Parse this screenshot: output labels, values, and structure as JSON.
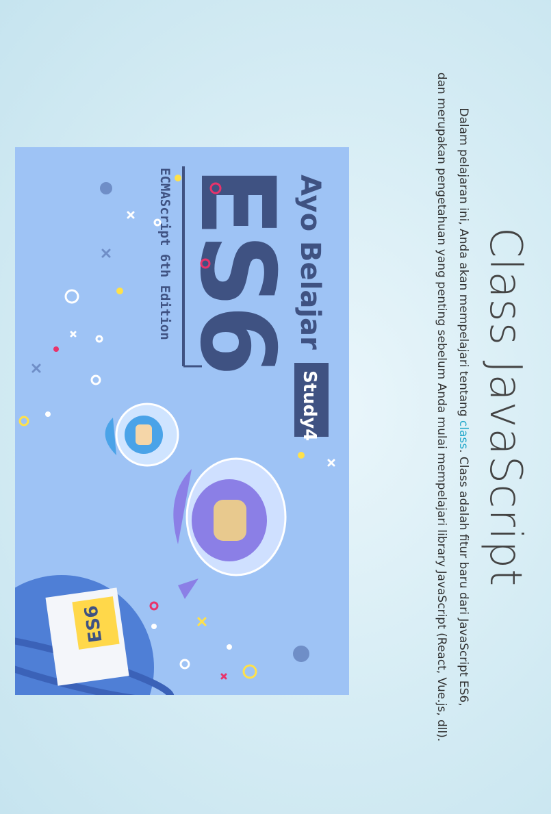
{
  "slide": {
    "title": "Class JavaScript",
    "desc_prefix": "Dalam pelajaran ini, Anda akan mempelajari tentang ",
    "desc_link": "class",
    "desc_suffix_line1": ". Class adalah fitur baru dari JavaScript ES6,",
    "desc_line2": "dan merupakan pengetahuan yang penting sebelum Anda mulai mempelajari library JavaScript (React, Vue.js, dll)."
  },
  "banner": {
    "heading": "Ayo Belajar",
    "logo": "ES6",
    "badge": "Study4",
    "subtitle": "ECMAScript 6th Edition",
    "flag": "ES6"
  },
  "colors": {
    "banner_bg": "#9ec3f5",
    "navy": "#3f5282",
    "link": "#1fa6c9"
  }
}
